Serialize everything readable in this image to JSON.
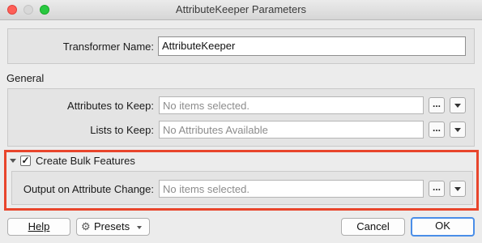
{
  "window": {
    "title": "AttributeKeeper Parameters"
  },
  "transformer": {
    "label": "Transformer Name:",
    "value": "AttributeKeeper"
  },
  "general": {
    "title": "General",
    "attributes_to_keep": {
      "label": "Attributes to Keep:",
      "placeholder": "No items selected.",
      "ellipsis": "..."
    },
    "lists_to_keep": {
      "label": "Lists to Keep:",
      "placeholder": "No Attributes Available",
      "ellipsis": "..."
    }
  },
  "bulk": {
    "checkbox_label": "Create Bulk Features",
    "checked": true,
    "check_mark": "✓",
    "output_label": "Output on Attribute Change:",
    "output_placeholder": "No items selected.",
    "ellipsis": "..."
  },
  "footer": {
    "help": "Help",
    "presets": "Presets",
    "cancel": "Cancel",
    "ok": "OK"
  },
  "colors": {
    "highlight": "#e8452c",
    "ok_border": "#4a8ee8"
  }
}
